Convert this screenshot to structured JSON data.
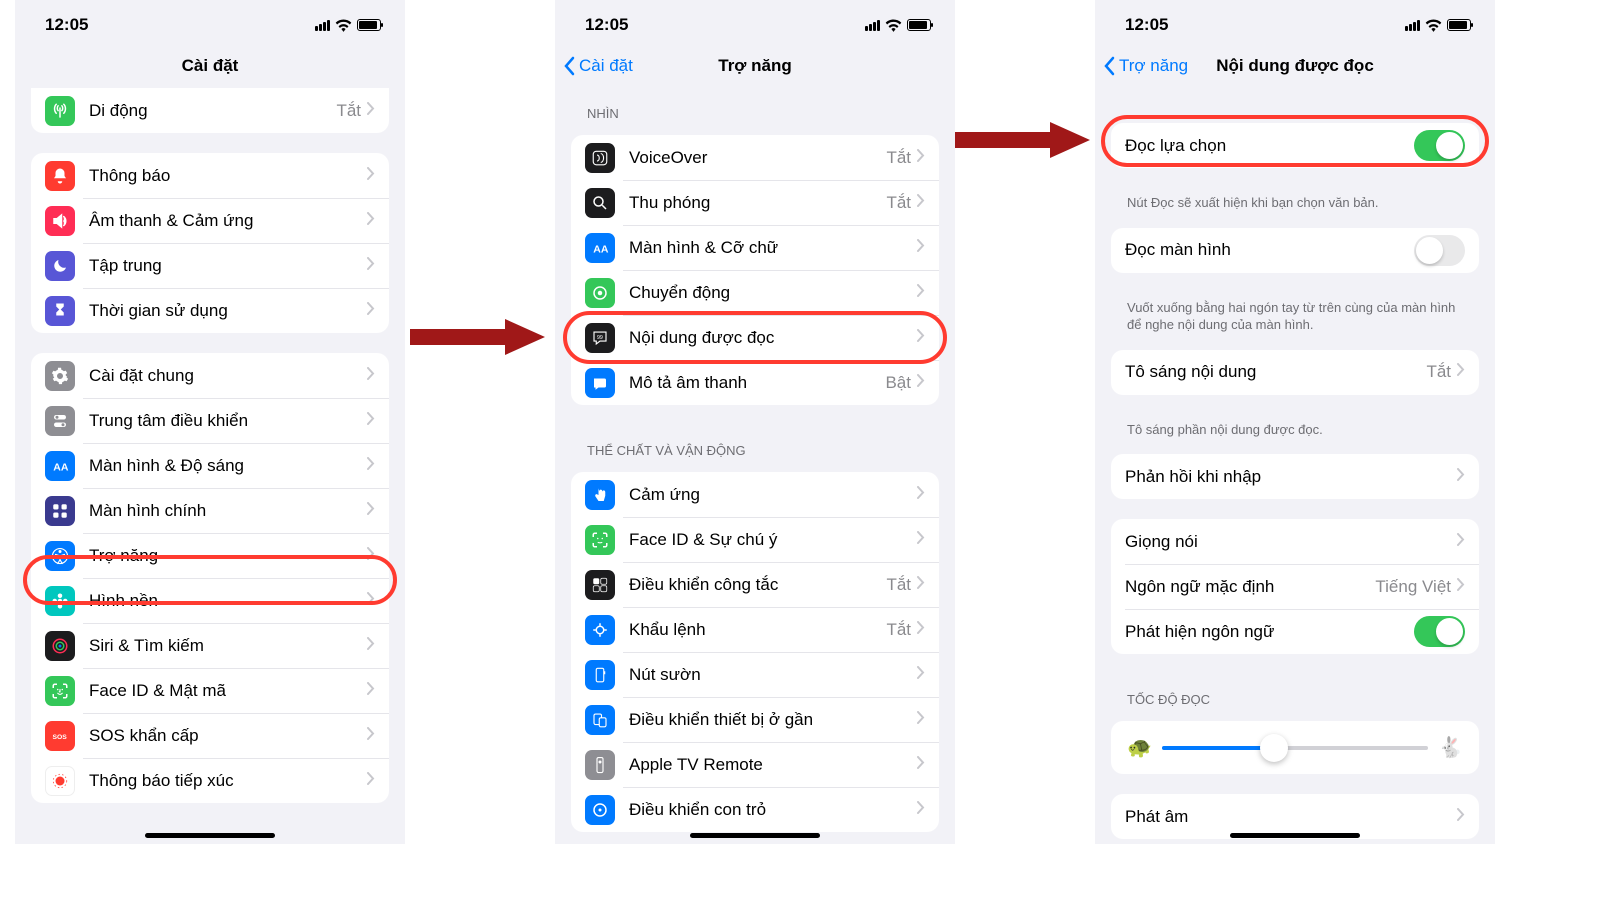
{
  "status": {
    "time": "12:05"
  },
  "p1": {
    "title": "Cài đặt",
    "g1": [
      {
        "label": "Di động",
        "value": "Tắt"
      }
    ],
    "g2": [
      {
        "label": "Thông báo"
      },
      {
        "label": "Âm thanh & Cảm ứng"
      },
      {
        "label": "Tập trung"
      },
      {
        "label": "Thời gian sử dụng"
      }
    ],
    "g3": [
      {
        "label": "Cài đặt chung"
      },
      {
        "label": "Trung tâm điều khiển"
      },
      {
        "label": "Màn hình & Độ sáng"
      },
      {
        "label": "Màn hình chính"
      },
      {
        "label": "Trợ năng"
      },
      {
        "label": "Hình nền"
      },
      {
        "label": "Siri & Tìm kiếm"
      },
      {
        "label": "Face ID & Mật mã"
      },
      {
        "label": "SOS khẩn cấp"
      },
      {
        "label": "Thông báo tiếp xúc"
      }
    ]
  },
  "p2": {
    "back": "Cài đặt",
    "title": "Trợ năng",
    "groups": [
      {
        "header": "NHÌN",
        "items": [
          {
            "label": "VoiceOver",
            "value": "Tắt"
          },
          {
            "label": "Thu phóng",
            "value": "Tắt"
          },
          {
            "label": "Màn hình & Cỡ chữ"
          },
          {
            "label": "Chuyển động"
          },
          {
            "label": "Nội dung được đọc"
          },
          {
            "label": "Mô tả âm thanh",
            "value": "Bật"
          }
        ]
      },
      {
        "header": "THỂ CHẤT VÀ VẬN ĐỘNG",
        "items": [
          {
            "label": "Cảm ứng"
          },
          {
            "label": "Face ID & Sự chú ý"
          },
          {
            "label": "Điều khiển công tắc",
            "value": "Tắt"
          },
          {
            "label": "Khẩu lệnh",
            "value": "Tắt"
          },
          {
            "label": "Nút sườn"
          },
          {
            "label": "Điều khiển thiết bị ở gần"
          },
          {
            "label": "Apple TV Remote"
          },
          {
            "label": "Điều khiển con trỏ"
          }
        ]
      }
    ]
  },
  "p3": {
    "back": "Trợ năng",
    "title": "Nội dung được đọc",
    "items": {
      "speak_selection": {
        "label": "Đọc lựa chọn",
        "on": true,
        "footer": "Nút Đọc sẽ xuất hiện khi bạn chọn văn bản."
      },
      "speak_screen": {
        "label": "Đọc màn hình",
        "on": false,
        "footer": "Vuốt xuống bằng hai ngón tay từ trên cùng của màn hình để nghe nội dung của màn hình."
      },
      "highlight": {
        "label": "Tô sáng nội dung",
        "value": "Tắt",
        "footer": "Tô sáng phần nội dung được đọc."
      },
      "typing_feedback": {
        "label": "Phản hồi khi nhập"
      },
      "voices": {
        "label": "Giọng nói"
      },
      "default_lang": {
        "label": "Ngôn ngữ mặc định",
        "value": "Tiếng Việt"
      },
      "detect_lang": {
        "label": "Phát hiện ngôn ngữ",
        "on": true
      },
      "speed_header": "TỐC ĐỘ ĐỌC",
      "speed_value_percent": 42,
      "pronunciation": {
        "label": "Phát âm"
      }
    }
  }
}
